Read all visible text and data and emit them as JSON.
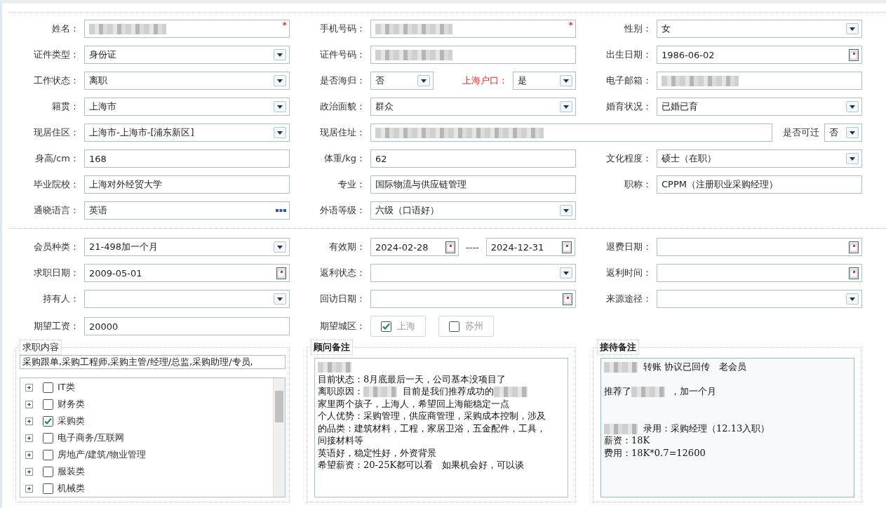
{
  "profile_rows": [
    [
      {
        "label": "姓名：",
        "kind": "text",
        "redacted": true,
        "required_mark": "*"
      },
      {
        "label": "手机号码：",
        "kind": "text",
        "redacted": true,
        "required_mark": "*"
      },
      {
        "label": "性别：",
        "kind": "select",
        "value": "女"
      }
    ],
    [
      {
        "label": "证件类型：",
        "kind": "select",
        "value": "身份证"
      },
      {
        "label": "证件号码：",
        "kind": "text",
        "redacted": true
      },
      {
        "label": "出生日期：",
        "kind": "date",
        "value": "1986-06-02"
      }
    ],
    [
      {
        "label": "工作状态：",
        "kind": "select",
        "value": "离职"
      },
      {
        "label": "是否海归：",
        "kind": "select",
        "value": "否",
        "inline": {
          "label": "上海户口：",
          "highlighted": true,
          "kind": "select",
          "value": "是"
        }
      },
      {
        "label": "电子邮箱：",
        "kind": "text",
        "redacted": true
      }
    ],
    [
      {
        "label": "籍贯：",
        "kind": "select",
        "value": "上海市"
      },
      {
        "label": "政治面貌：",
        "kind": "select",
        "value": "群众"
      },
      {
        "label": "婚育状况：",
        "kind": "select",
        "value": "已婚已育"
      }
    ],
    [
      {
        "label": "现居住区：",
        "kind": "select",
        "value": "上海市-上海市-[浦东新区]"
      },
      {
        "label": "现居住址：",
        "kind": "text",
        "redacted": true,
        "wide": true,
        "inline": {
          "label": "是否可迁",
          "highlighted": false,
          "kind": "select",
          "value": "否"
        }
      }
    ],
    [
      {
        "label": "身高/cm：",
        "kind": "text",
        "value": "168"
      },
      {
        "label": "体重/kg：",
        "kind": "text",
        "value": "62"
      },
      {
        "label": "文化程度：",
        "kind": "select",
        "value": "硕士（在职）"
      }
    ],
    [
      {
        "label": "毕业院校：",
        "kind": "text",
        "value": "上海对外经贸大学"
      },
      {
        "label": "专业：",
        "kind": "text",
        "value": "国际物流与供应链管理"
      },
      {
        "label": "职称：",
        "kind": "text",
        "value": "CPPM（注册职业采购经理）"
      }
    ],
    [
      {
        "label": "通晓语言：",
        "kind": "lookup",
        "value": "英语"
      },
      {
        "label": "外语等级：",
        "kind": "select",
        "value": "六级（口语好）"
      }
    ]
  ],
  "membership_rows": [
    [
      {
        "label": "会员种类：",
        "kind": "select",
        "value": "21-498加一个月"
      },
      {
        "label": "有效期：",
        "kind": "daterange",
        "values": [
          "2024-02-28",
          "2024-12-31"
        ],
        "separator": "----"
      },
      {
        "label": "退费日期：",
        "kind": "date"
      }
    ],
    [
      {
        "label": "求职日期：",
        "kind": "date",
        "value": "2009-05-01"
      },
      {
        "label": "返利状态：",
        "kind": "select"
      },
      {
        "label": "返利时间：",
        "kind": "date"
      }
    ],
    [
      {
        "label": "持有人：",
        "kind": "select"
      },
      {
        "label": "回访日期：",
        "kind": "date"
      },
      {
        "label": "来源途径：",
        "kind": "select"
      }
    ],
    [
      {
        "label": "期望工资：",
        "kind": "text",
        "value": "20000"
      },
      {
        "label": "期望城区：",
        "kind": "checkboxes",
        "options": [
          {
            "label": "上海",
            "checked": true
          },
          {
            "label": "苏州",
            "checked": false
          }
        ]
      }
    ]
  ],
  "panels": [
    {
      "kind": "tree",
      "title": "求职内容",
      "summary": "采购跟单,采购工程师,采购主管/经理/总监,采购助理/专员,",
      "items": [
        {
          "label": "IT类",
          "checked": false,
          "expanded": false
        },
        {
          "label": "财务类",
          "checked": false,
          "expanded": false
        },
        {
          "label": "采购类",
          "checked": true,
          "expanded": false
        },
        {
          "label": "电子商务/互联网",
          "checked": false,
          "expanded": false
        },
        {
          "label": "房地产/建筑/物业管理",
          "checked": false,
          "expanded": false
        },
        {
          "label": "服装类",
          "checked": false,
          "expanded": false
        },
        {
          "label": "机械类",
          "checked": false,
          "expanded": false
        }
      ]
    },
    {
      "kind": "notes",
      "title": "顾问备注",
      "tinted": false,
      "lines": [
        {
          "kind": "text",
          "parts": [
            {
              "kind": "redacted"
            }
          ]
        },
        {
          "kind": "text",
          "parts": [
            {
              "kind": "text",
              "text": "目前状态：8月底最后一天，公司基本没项目了"
            }
          ]
        },
        {
          "kind": "text",
          "parts": [
            {
              "kind": "text",
              "text": "离职原因："
            },
            {
              "kind": "redacted"
            },
            {
              "kind": "text",
              "text": "目前是我们推荐成功的"
            },
            {
              "kind": "redacted"
            }
          ]
        },
        {
          "kind": "text",
          "parts": [
            {
              "kind": "text",
              "text": "家里两个孩子，上海人，希望回上海能稳定一点"
            }
          ]
        },
        {
          "kind": "text",
          "parts": [
            {
              "kind": "text",
              "text": "个人优势：采购管理，供应商管理，采购成本控制，涉及"
            }
          ]
        },
        {
          "kind": "text",
          "parts": [
            {
              "kind": "text",
              "text": "的品类：建筑材料，工程，家居卫浴，五金配件，工具，"
            }
          ]
        },
        {
          "kind": "text",
          "parts": [
            {
              "kind": "text",
              "text": "间接材料等"
            }
          ]
        },
        {
          "kind": "text",
          "parts": [
            {
              "kind": "text",
              "text": "英语好，稳定性好，外资背景"
            }
          ]
        },
        {
          "kind": "text",
          "parts": [
            {
              "kind": "text",
              "text": "希望薪资：20-25K都可以看　如果机会好，可以谈"
            }
          ]
        }
      ]
    },
    {
      "kind": "notes",
      "title": "接待备注",
      "tinted": true,
      "lines": [
        {
          "kind": "text",
          "parts": [
            {
              "kind": "redacted"
            },
            {
              "kind": "text",
              "text": "转账 协议已回传　老会员"
            }
          ]
        },
        {
          "kind": "blank"
        },
        {
          "kind": "text",
          "parts": [
            {
              "kind": "text",
              "text": "推荐了"
            },
            {
              "kind": "redacted"
            },
            {
              "kind": "text",
              "text": "，加一个月"
            }
          ]
        },
        {
          "kind": "blank"
        },
        {
          "kind": "blank"
        },
        {
          "kind": "text",
          "parts": [
            {
              "kind": "redacted"
            },
            {
              "kind": "text",
              "text": "录用：采购经理（12.13入职）"
            }
          ]
        },
        {
          "kind": "text",
          "parts": [
            {
              "kind": "text",
              "text": "薪资：18K"
            }
          ]
        },
        {
          "kind": "text",
          "parts": [
            {
              "kind": "text",
              "text": "费用：18K*0.7=12600"
            }
          ]
        }
      ]
    }
  ]
}
